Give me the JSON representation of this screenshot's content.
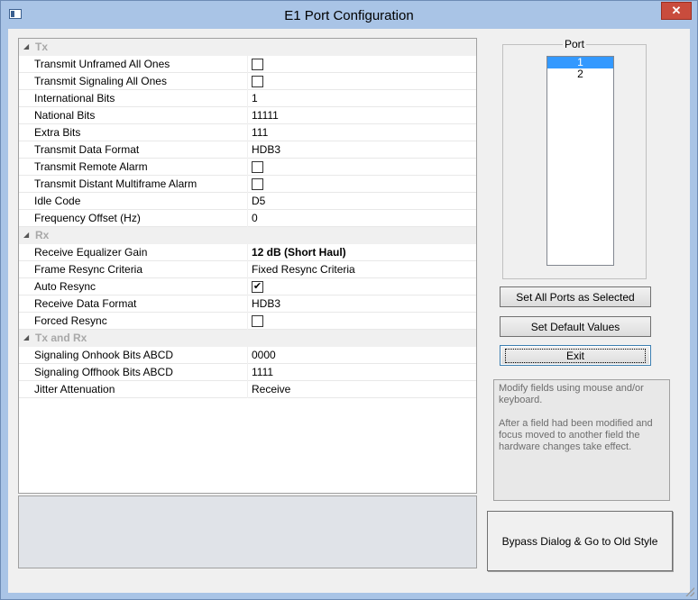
{
  "window": {
    "title": "E1 Port Configuration",
    "close_label": "✕"
  },
  "grid": {
    "rows": [
      {
        "type": "cat",
        "label": "Tx"
      },
      {
        "type": "check",
        "name": "Transmit Unframed All Ones",
        "checked": false
      },
      {
        "type": "check",
        "name": "Transmit Signaling All Ones",
        "checked": false
      },
      {
        "type": "text",
        "name": "International Bits",
        "value": "1"
      },
      {
        "type": "text",
        "name": "National Bits",
        "value": "11111"
      },
      {
        "type": "text",
        "name": "Extra Bits",
        "value": "111"
      },
      {
        "type": "text",
        "name": "Transmit Data Format",
        "value": "HDB3"
      },
      {
        "type": "check",
        "name": "Transmit Remote Alarm",
        "checked": false
      },
      {
        "type": "check",
        "name": "Transmit Distant Multiframe Alarm",
        "checked": false
      },
      {
        "type": "text",
        "name": "Idle Code",
        "value": "D5"
      },
      {
        "type": "text",
        "name": "Frequency Offset (Hz)",
        "value": "0"
      },
      {
        "type": "cat",
        "label": "Rx"
      },
      {
        "type": "text",
        "name": "Receive Equalizer Gain",
        "value": "12 dB (Short Haul)",
        "bold": true
      },
      {
        "type": "text",
        "name": "Frame Resync Criteria",
        "value": "Fixed Resync Criteria"
      },
      {
        "type": "check",
        "name": "Auto Resync",
        "checked": true
      },
      {
        "type": "text",
        "name": "Receive Data Format",
        "value": "HDB3"
      },
      {
        "type": "check",
        "name": "Forced Resync",
        "checked": false
      },
      {
        "type": "cat",
        "label": "Tx and Rx"
      },
      {
        "type": "text",
        "name": "Signaling Onhook Bits ABCD",
        "value": "0000"
      },
      {
        "type": "text",
        "name": "Signaling Offhook Bits ABCD",
        "value": "1111"
      },
      {
        "type": "text",
        "name": "Jitter Attenuation",
        "value": "Receive"
      }
    ]
  },
  "port": {
    "legend": "Port",
    "items": [
      {
        "label": "1",
        "selected": true
      },
      {
        "label": "2",
        "selected": false
      }
    ]
  },
  "buttons": {
    "set_all": "Set All Ports as Selected",
    "set_default": "Set Default Values",
    "exit": "Exit",
    "bypass": "Bypass  Dialog & Go to Old Style"
  },
  "help": {
    "line1": "Modify fields using mouse and/or keyboard.",
    "line2": "After a field had been modified and focus moved to another field the hardware changes take effect."
  }
}
